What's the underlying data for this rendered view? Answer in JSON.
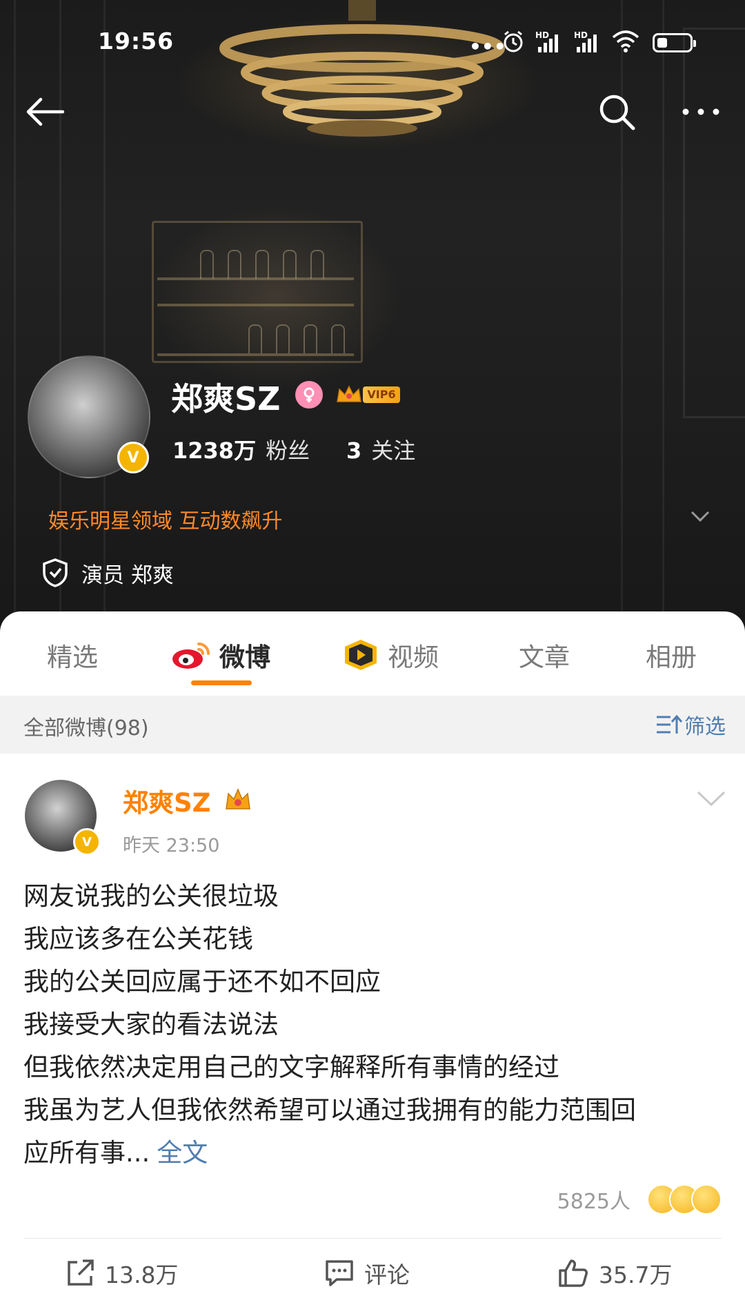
{
  "status_bar": {
    "time": "19:56",
    "signal1": "HD",
    "signal2": "HD"
  },
  "nav": {
    "back_icon": "arrow-left-icon",
    "search_icon": "search-icon",
    "more_icon": "more-horizontal-icon"
  },
  "profile": {
    "name": "郑爽SZ",
    "vip_level": "VIP6",
    "followers_count": "1238万",
    "followers_label": "粉丝",
    "following_count": "3",
    "following_label": "关注",
    "promo_text": "娱乐明星领域 互动数飙升",
    "certification": "演员 郑爽"
  },
  "tabs": [
    {
      "label": "精选"
    },
    {
      "label": "微博"
    },
    {
      "label": "视频"
    },
    {
      "label": "文章"
    },
    {
      "label": "相册"
    }
  ],
  "filter": {
    "count_label": "全部微博(98)",
    "filter_label": "筛选"
  },
  "post": {
    "author": "郑爽SZ",
    "time": "昨天 23:50",
    "lines": [
      "网友说我的公关很垃圾",
      "我应该多在公关花钱",
      "我的公关回应属于还不如不回应",
      "我接受大家的看法说法",
      "但我依然决定用自己的文字解释所有事情的经过",
      "我虽为艺人但我依然希望可以通过我拥有的能力范围回",
      "应所有事..."
    ],
    "more_link": "全文",
    "reaction_count": "5825人",
    "repost_count": "13.8万",
    "comment_label": "评论",
    "like_count": "35.7万"
  },
  "colors": {
    "accent_orange": "#ff8200",
    "link_blue": "#507daf",
    "vip_gold": "#f5b400"
  }
}
